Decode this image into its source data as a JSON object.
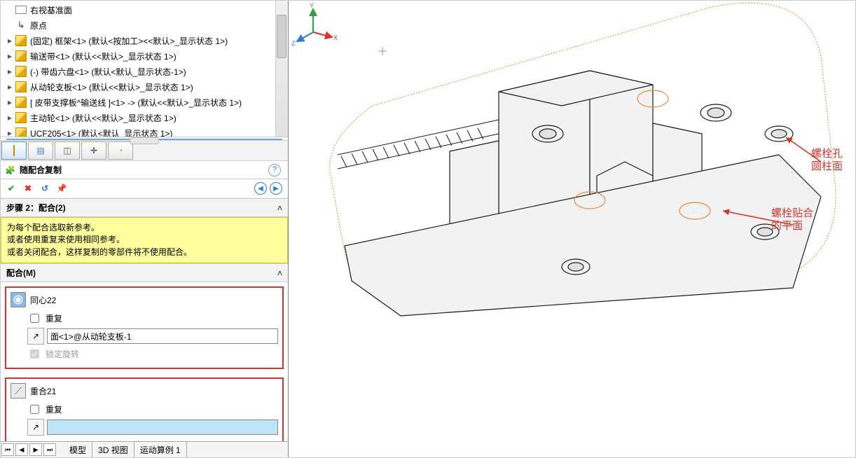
{
  "tree": {
    "items": [
      {
        "icon": "plane",
        "caret": "",
        "label": "右视基准面"
      },
      {
        "icon": "origin",
        "caret": "",
        "label": "原点"
      },
      {
        "icon": "cube",
        "caret": "▸",
        "label": "(固定) 框架<1> (默认<按加工><<默认>_显示状态 1>)"
      },
      {
        "icon": "cube",
        "caret": "▸",
        "label": "输送带<1> (默认<<默认>_显示状态 1>)"
      },
      {
        "icon": "cube",
        "caret": "▸",
        "label": "(-) 带齿六盘<1> (默认<默认_显示状态-1>)"
      },
      {
        "icon": "cube",
        "caret": "▸",
        "label": "从动轮支板<1> (默认<<默认>_显示状态 1>)"
      },
      {
        "icon": "cube",
        "caret": "▸",
        "label": "[ 皮带支撑板^输送线 ]<1> -> (默认<<默认>_显示状态 1>)"
      },
      {
        "icon": "cube",
        "caret": "▸",
        "label": "主动轮<1> (默认<<默认>_显示状态 1>)"
      },
      {
        "icon": "cube",
        "caret": "▸",
        "label": "UCF205<1> (默认<默认_显示状态 1>)"
      }
    ]
  },
  "pm": {
    "title": "随配合复制",
    "step_header": "步骤 2：配合(2)",
    "tip_line1": "为每个配合选取新参考。",
    "tip_line2": "或者使用重复来使用相同参考。",
    "tip_line3": "或者关闭配合，这样复制的零部件将不使用配合。",
    "mates_header": "配合(M)",
    "mate1": {
      "name": "同心22",
      "repeat": "重复",
      "ref": "面<1>@从动轮支板-1",
      "lock": "锁定旋转"
    },
    "mate2": {
      "name": "重合21",
      "repeat": "重复",
      "ref": ""
    }
  },
  "bottom_tabs": [
    "模型",
    "3D 视图",
    "运动算例 1"
  ],
  "annotations": {
    "a1_l1": "螺栓孔",
    "a1_l2": "圆柱面",
    "a2_l1": "螺栓贴合",
    "a2_l2": "的平面"
  },
  "triad": {
    "x": "X",
    "y": "Y",
    "z": "Z"
  }
}
